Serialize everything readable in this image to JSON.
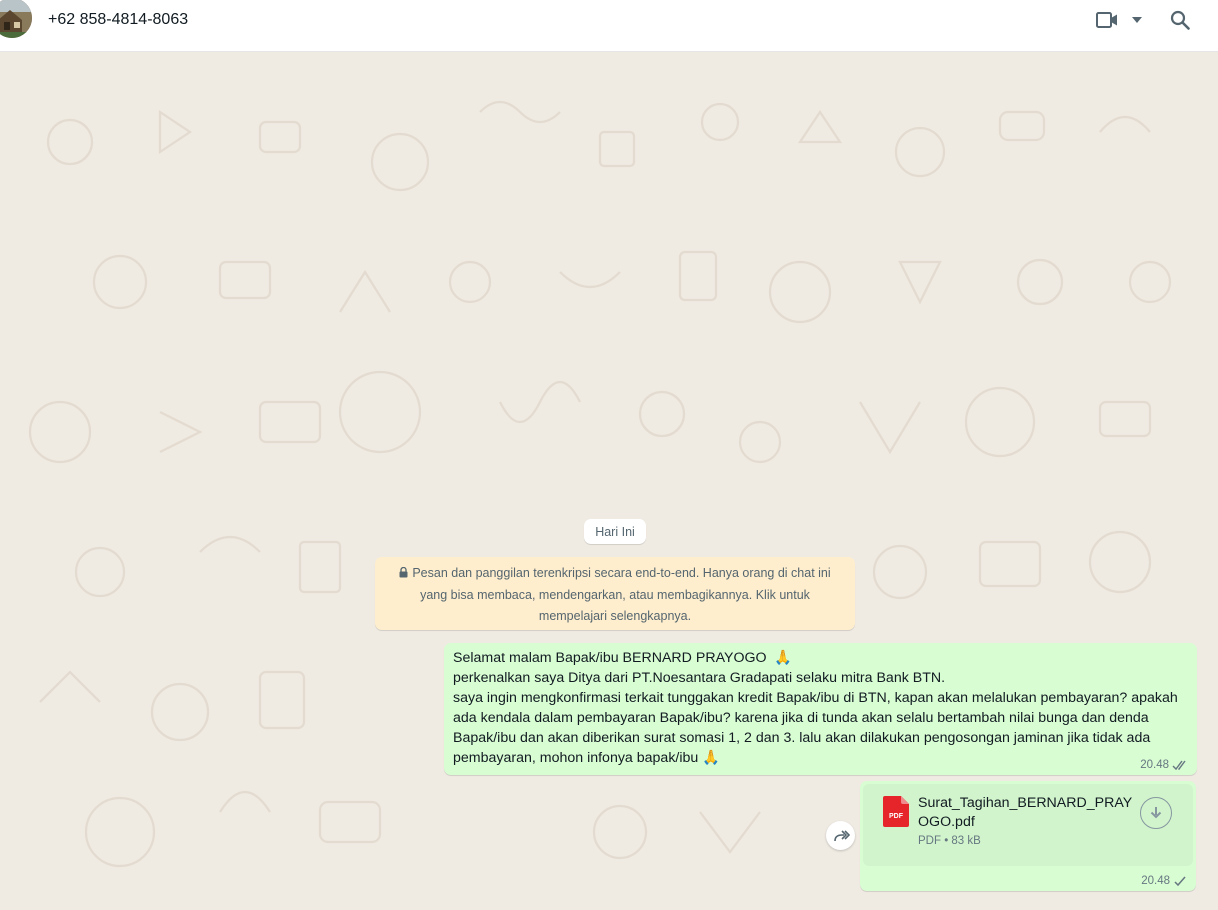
{
  "header": {
    "contact_name": "+62 858-4814-8063",
    "icons": [
      "avatar",
      "video-call-icon",
      "chevron-down-icon",
      "search-icon"
    ]
  },
  "chat": {
    "date_chip": "Hari Ini",
    "encryption_notice": "Pesan dan panggilan terenkripsi secara end-to-end. Hanya orang di chat ini yang bisa membaca, mendengarkan, atau membagikannya. Klik untuk mempelajari selengkapnya.",
    "messages": [
      {
        "text": "Selamat malam Bapak/ibu BERNARD PRAYOGO  🙏\nperkenalkan saya Ditya dari PT.Noesantara Gradapati selaku mitra Bank BTN.\nsaya ingin mengkonfirmasi terkait tunggakan kredit Bapak/ibu di BTN, kapan akan melalukan pembayaran? apakah ada kendala dalam pembayaran Bapak/ibu? karena jika di tunda akan selalu bertambah nilai bunga dan denda Bapak/ibu dan akan diberikan surat somasi 1, 2 dan 3. lalu akan dilakukan pengosongan jaminan jika tidak ada pembayaran, mohon infonya bapak/ibu 🙏",
        "time": "20.48",
        "status": "delivered-double-check"
      },
      {
        "file_name": "Surat_Tagihan_BERNARD_PRAYOGO.pdf",
        "file_type_label": "PDF",
        "file_info": "PDF • 83 kB",
        "time": "20.48",
        "status": "sent-single-check"
      }
    ]
  },
  "colors": {
    "chat_background": "#efeae2",
    "outgoing_bubble": "#d9fdd3",
    "system_notice": "#ffeecd",
    "pdf_red": "#e5252a",
    "meta_text": "#667781"
  }
}
